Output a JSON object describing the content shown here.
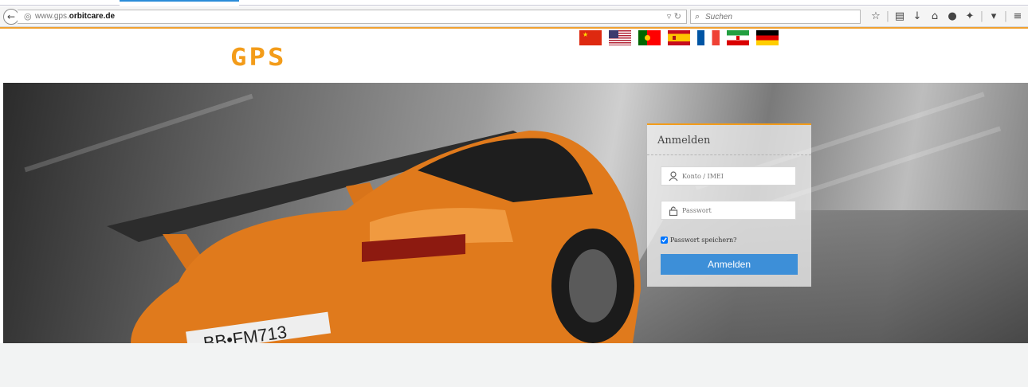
{
  "browser": {
    "url_host_prefix": "www.gps.",
    "url_host_domain": "orbitcare.de",
    "search_placeholder": "Suchen"
  },
  "site": {
    "logo_text": "GPS",
    "languages": [
      "Chinese",
      "English",
      "Portuguese",
      "Spanish",
      "French",
      "Iranian",
      "German"
    ]
  },
  "login": {
    "title": "Anmelden",
    "account_placeholder": "Konto / IMEI",
    "password_placeholder": "Passwort",
    "remember_label": "Passwort speichern?",
    "remember_checked": true,
    "submit_label": "Anmelden"
  },
  "colors": {
    "accent": "#f39c1a",
    "button": "#3d8fd8"
  }
}
